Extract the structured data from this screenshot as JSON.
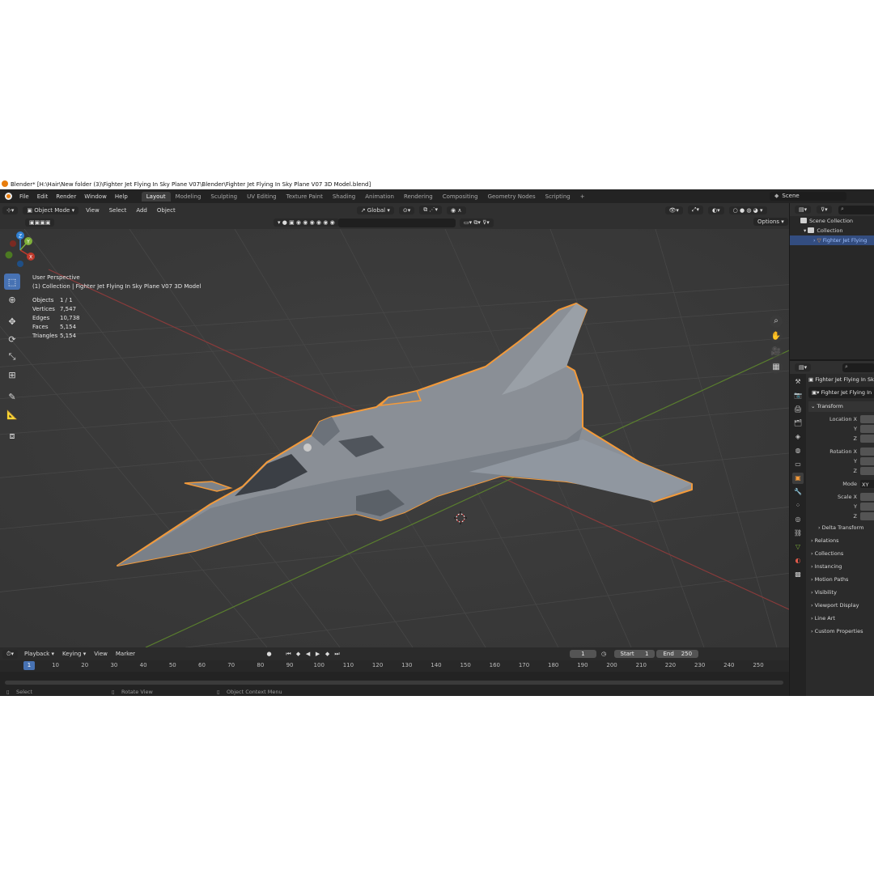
{
  "window": {
    "title": "Blender* [H:\\Hair\\New folder (3)\\Fighter Jet Flying In Sky Plane V07\\Blender\\Fighter Jet Flying In Sky Plane V07 3D Model.blend]"
  },
  "menu": [
    "File",
    "Edit",
    "Render",
    "Window",
    "Help"
  ],
  "workspaces": [
    "Layout",
    "Modeling",
    "Sculpting",
    "UV Editing",
    "Texture Paint",
    "Shading",
    "Animation",
    "Rendering",
    "Compositing",
    "Geometry Nodes",
    "Scripting"
  ],
  "workspace_add": "+",
  "scene": {
    "label": "Scene"
  },
  "viewport_header": {
    "mode": "Object Mode",
    "menus": [
      "View",
      "Select",
      "Add",
      "Object"
    ],
    "transform_orientation": "Global",
    "options": "Options"
  },
  "viewport": {
    "view_name": "User Perspective",
    "collection_path": "(1) Collection | Fighter Jet Flying In Sky Plane V07 3D Model",
    "stats": [
      {
        "label": "Objects",
        "value": "1 / 1"
      },
      {
        "label": "Vertices",
        "value": "7,547"
      },
      {
        "label": "Edges",
        "value": "10,738"
      },
      {
        "label": "Faces",
        "value": "5,154"
      },
      {
        "label": "Triangles",
        "value": "5,154"
      }
    ],
    "gizmo": {
      "z": "Z",
      "y": "Y",
      "x": "X"
    }
  },
  "timeline": {
    "menus": [
      "Playback",
      "Keying",
      "View",
      "Marker"
    ],
    "current_frame": "1",
    "start_label": "Start",
    "start": "1",
    "end_label": "End",
    "end": "250",
    "ticks": [
      "1",
      "10",
      "20",
      "30",
      "40",
      "50",
      "60",
      "70",
      "80",
      "90",
      "100",
      "110",
      "120",
      "130",
      "140",
      "150",
      "160",
      "170",
      "180",
      "190",
      "200",
      "210",
      "220",
      "230",
      "240",
      "250"
    ]
  },
  "statusbar": {
    "select": "Select",
    "rotate": "Rotate View",
    "context": "Object Context Menu"
  },
  "outliner": {
    "rows": [
      "Scene Collection",
      "Collection",
      "Fighter Jet Flying"
    ]
  },
  "properties": {
    "object_name": "Fighter Jet Flying In Sk",
    "object_field": "Fighter Jet Flying In",
    "transform": "Transform",
    "location_x": "Location X",
    "rotation_x": "Rotation X",
    "y": "Y",
    "z": "Z",
    "mode": "Mode",
    "mode_value": "XY",
    "scale_x": "Scale X",
    "delta_transform": "Delta Transform",
    "sections": [
      "Relations",
      "Collections",
      "Instancing",
      "Motion Paths",
      "Visibility",
      "Viewport Display",
      "Line Art",
      "Custom Properties"
    ]
  },
  "colors": {
    "accent": "#4772b3",
    "selection_outline": "#f39a3a",
    "axis_x": "#c0392b",
    "axis_y": "#7fb03a",
    "axis_z": "#2f7fd1"
  }
}
